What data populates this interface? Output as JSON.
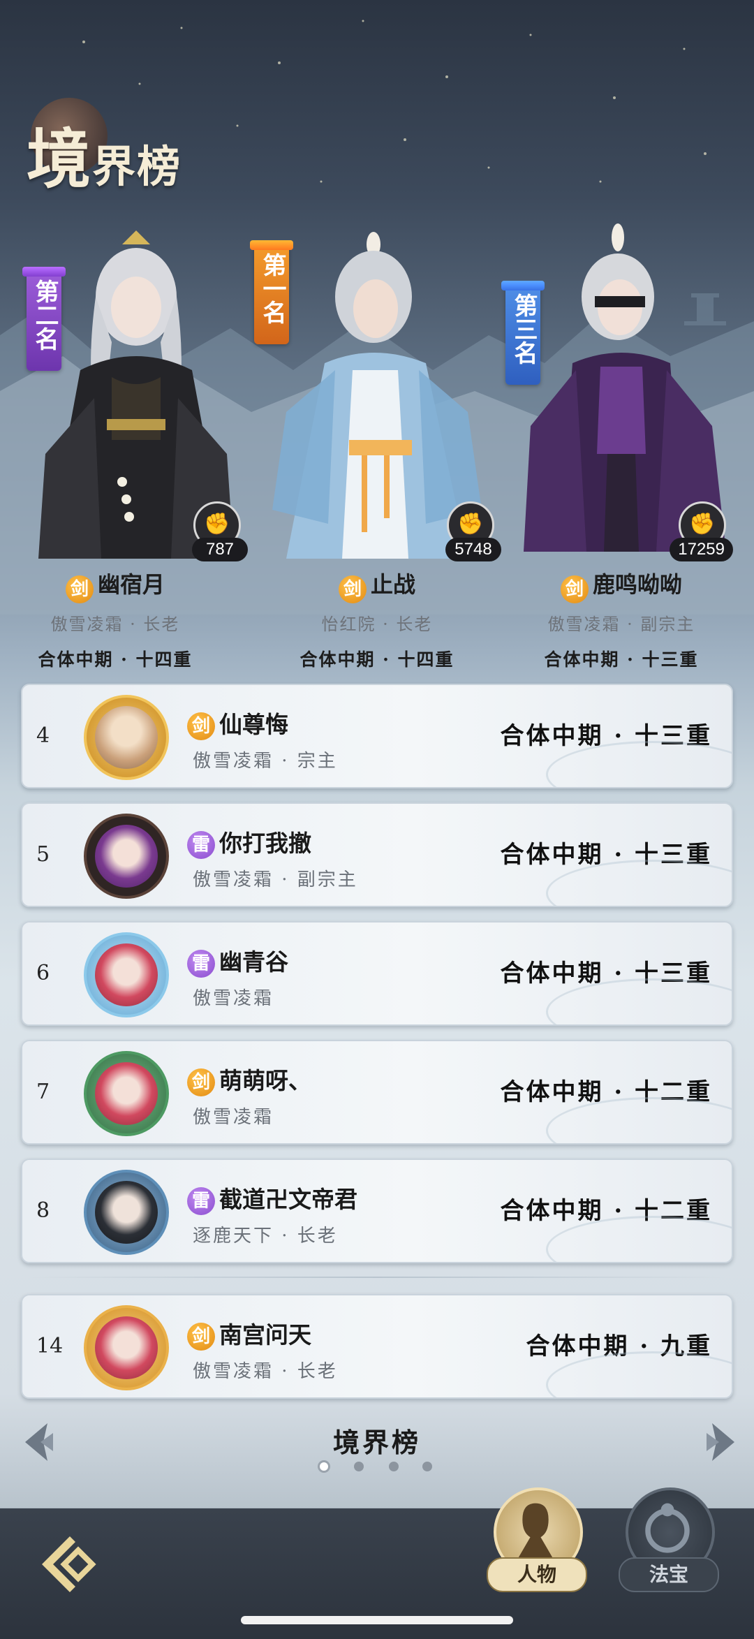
{
  "title": {
    "big": "境",
    "rest": "界榜"
  },
  "podium": [
    {
      "banner": "第二名",
      "power": "787",
      "element": "剑",
      "name": "幽宿月",
      "guild": "傲雪凌霜 · 长老",
      "realm": "合体中期 · 十四重",
      "color": "#9b5cd8"
    },
    {
      "banner": "第一名",
      "power": "5748",
      "element": "剑",
      "name": "止战",
      "guild": "怡红院 · 长老",
      "realm": "合体中期 · 十四重",
      "color": "#f39a2b"
    },
    {
      "banner": "第三名",
      "power": "17259",
      "element": "剑",
      "name": "鹿鸣呦呦",
      "guild": "傲雪凌霜 · 副宗主",
      "realm": "合体中期 · 十三重",
      "color": "#4e8de6"
    }
  ],
  "list": [
    {
      "rank": "4",
      "element": "剑",
      "name": "仙尊悔",
      "guild": "傲雪凌霜 · 宗主",
      "realm": "合体中期 · 十三重",
      "frame": "#d99b2e"
    },
    {
      "rank": "5",
      "element": "雷",
      "name": "你打我撤",
      "guild": "傲雪凌霜 · 副宗主",
      "realm": "合体中期 · 十三重",
      "frame": "#3b2a26"
    },
    {
      "rank": "6",
      "element": "雷",
      "name": "幽青谷",
      "guild": "傲雪凌霜",
      "realm": "合体中期 · 十三重",
      "frame": "#7fc0e8"
    },
    {
      "rank": "7",
      "element": "剑",
      "name": "萌萌呀、",
      "guild": "傲雪凌霜",
      "realm": "合体中期 · 十二重",
      "frame": "#3f8d57"
    },
    {
      "rank": "8",
      "element": "雷",
      "name": "截道卍文帝君",
      "guild": "逐鹿天下 · 长老",
      "realm": "合体中期 · 十二重",
      "frame": "#4f7ea8"
    },
    {
      "rank": "14",
      "element": "剑",
      "name": "南宫问天",
      "guild": "傲雪凌霜 · 长老",
      "realm": "合体中期 · 九重",
      "frame": "#e0a23a"
    }
  ],
  "pager": {
    "title": "境界榜",
    "pages": 4,
    "current": 0
  },
  "nav": {
    "character": "人物",
    "treasure": "法宝"
  },
  "icons": {
    "back": "back-arrow-icon",
    "prev": "chevron-left-icon",
    "next": "chevron-right-icon",
    "power": "fist-icon"
  }
}
